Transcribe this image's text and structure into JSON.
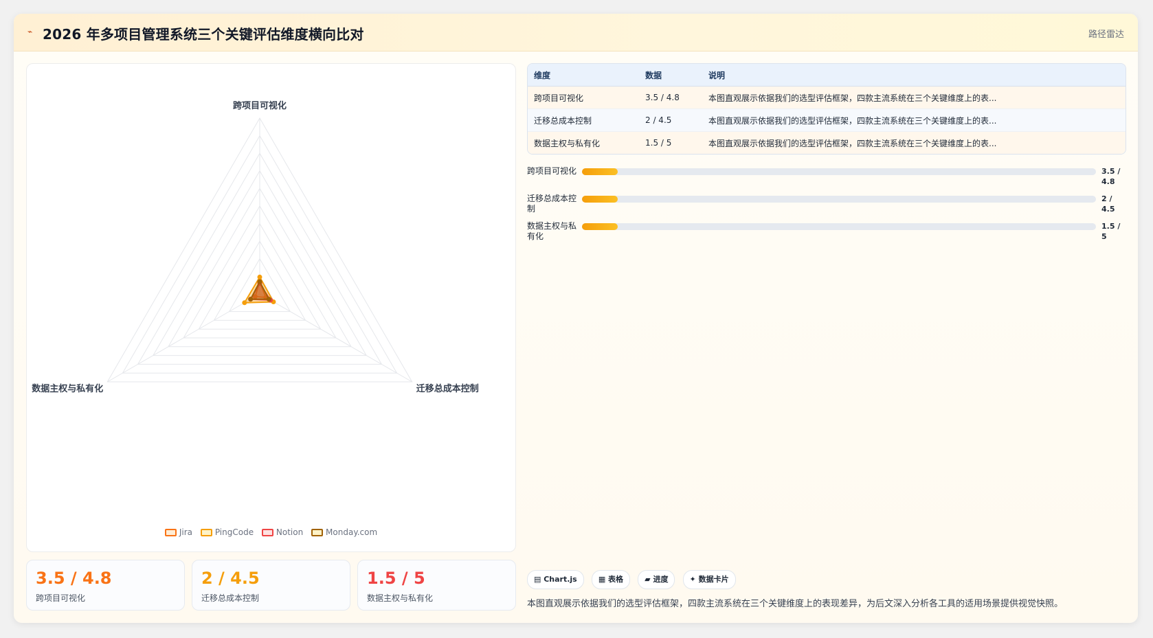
{
  "header": {
    "icon": "⌁",
    "title": "2026 年多项目管理系统三个关键评估维度横向比对",
    "tag": "路径雷达"
  },
  "chart_data": {
    "type": "radar",
    "axes": [
      "跨项目可视化",
      "迁移总成本控制",
      "数据主权与私有化"
    ],
    "rmax": 5,
    "rings": 10,
    "series": [
      {
        "name": "Jira",
        "color": "#f97316",
        "values": [
          0.35,
          0.2,
          0.15
        ]
      },
      {
        "name": "PingCode",
        "color": "#f59e0b",
        "values": [
          0.48,
          0.45,
          0.5
        ]
      },
      {
        "name": "Notion",
        "color": "#ef4444",
        "values": [
          0.3,
          0.35,
          0.3
        ]
      },
      {
        "name": "Monday.com",
        "color": "#a16207",
        "values": [
          0.35,
          0.3,
          0.3
        ]
      }
    ]
  },
  "legend": [
    "Jira",
    "PingCode",
    "Notion",
    "Monday.com"
  ],
  "kpis": [
    {
      "value": "3.5 / 4.8",
      "label": "跨项目可视化",
      "color": "#f97316"
    },
    {
      "value": "2 / 4.5",
      "label": "迁移总成本控制",
      "color": "#f59e0b"
    },
    {
      "value": "1.5 / 5",
      "label": "数据主权与私有化",
      "color": "#ef4444"
    }
  ],
  "table": {
    "headers": [
      "维度",
      "数据",
      "说明"
    ],
    "rows": [
      [
        "跨项目可视化",
        "3.5 / 4.8",
        "本图直观展示依据我们的选型评估框架，四款主流系统在三个关键维度上的表..."
      ],
      [
        "迁移总成本控制",
        "2 / 4.5",
        "本图直观展示依据我们的选型评估框架，四款主流系统在三个关键维度上的表..."
      ],
      [
        "数据主权与私有化",
        "1.5 / 5",
        "本图直观展示依据我们的选型评估框架，四款主流系统在三个关键维度上的表..."
      ]
    ]
  },
  "progress": [
    {
      "label": "跨项目可视化",
      "value": "3.5 / 4.8",
      "fraction": 0.07
    },
    {
      "label": "迁移总成本控制",
      "value": "2 / 4.5",
      "fraction": 0.07
    },
    {
      "label": "数据主权与私有化",
      "value": "1.5 / 5",
      "fraction": 0.07
    }
  ],
  "chips": [
    "▤ Chart.js",
    "▦ 表格",
    "▰ 进度",
    "✦ 数据卡片"
  ],
  "description": "本图直观展示依据我们的选型评估框架，四款主流系统在三个关键维度上的表现差异，为后文深入分析各工具的适用场景提供视觉快照。"
}
